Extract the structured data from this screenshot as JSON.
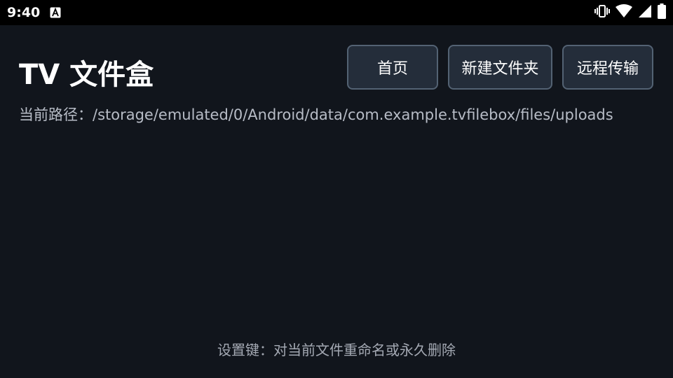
{
  "status_bar": {
    "time": "9:40",
    "icons": [
      "accessibility-a-icon",
      "vibrate-icon",
      "wifi-icon",
      "signal-icon",
      "battery-icon"
    ]
  },
  "app": {
    "title": "TV 文件盒",
    "buttons": {
      "home": "首页",
      "new_folder": "新建文件夹",
      "remote_transfer": "远程传输"
    },
    "current_path_label": "当前路径：/storage/emulated/0/Android/data/com.example.tvfilebox/files/uploads",
    "hint": "设置键：对当前文件重命名或永久删除"
  },
  "colors": {
    "background": "#11151c",
    "status_bar": "#000000",
    "button_bg": "#242d3a",
    "button_border": "#536273",
    "secondary_text": "#b7bcc6"
  }
}
